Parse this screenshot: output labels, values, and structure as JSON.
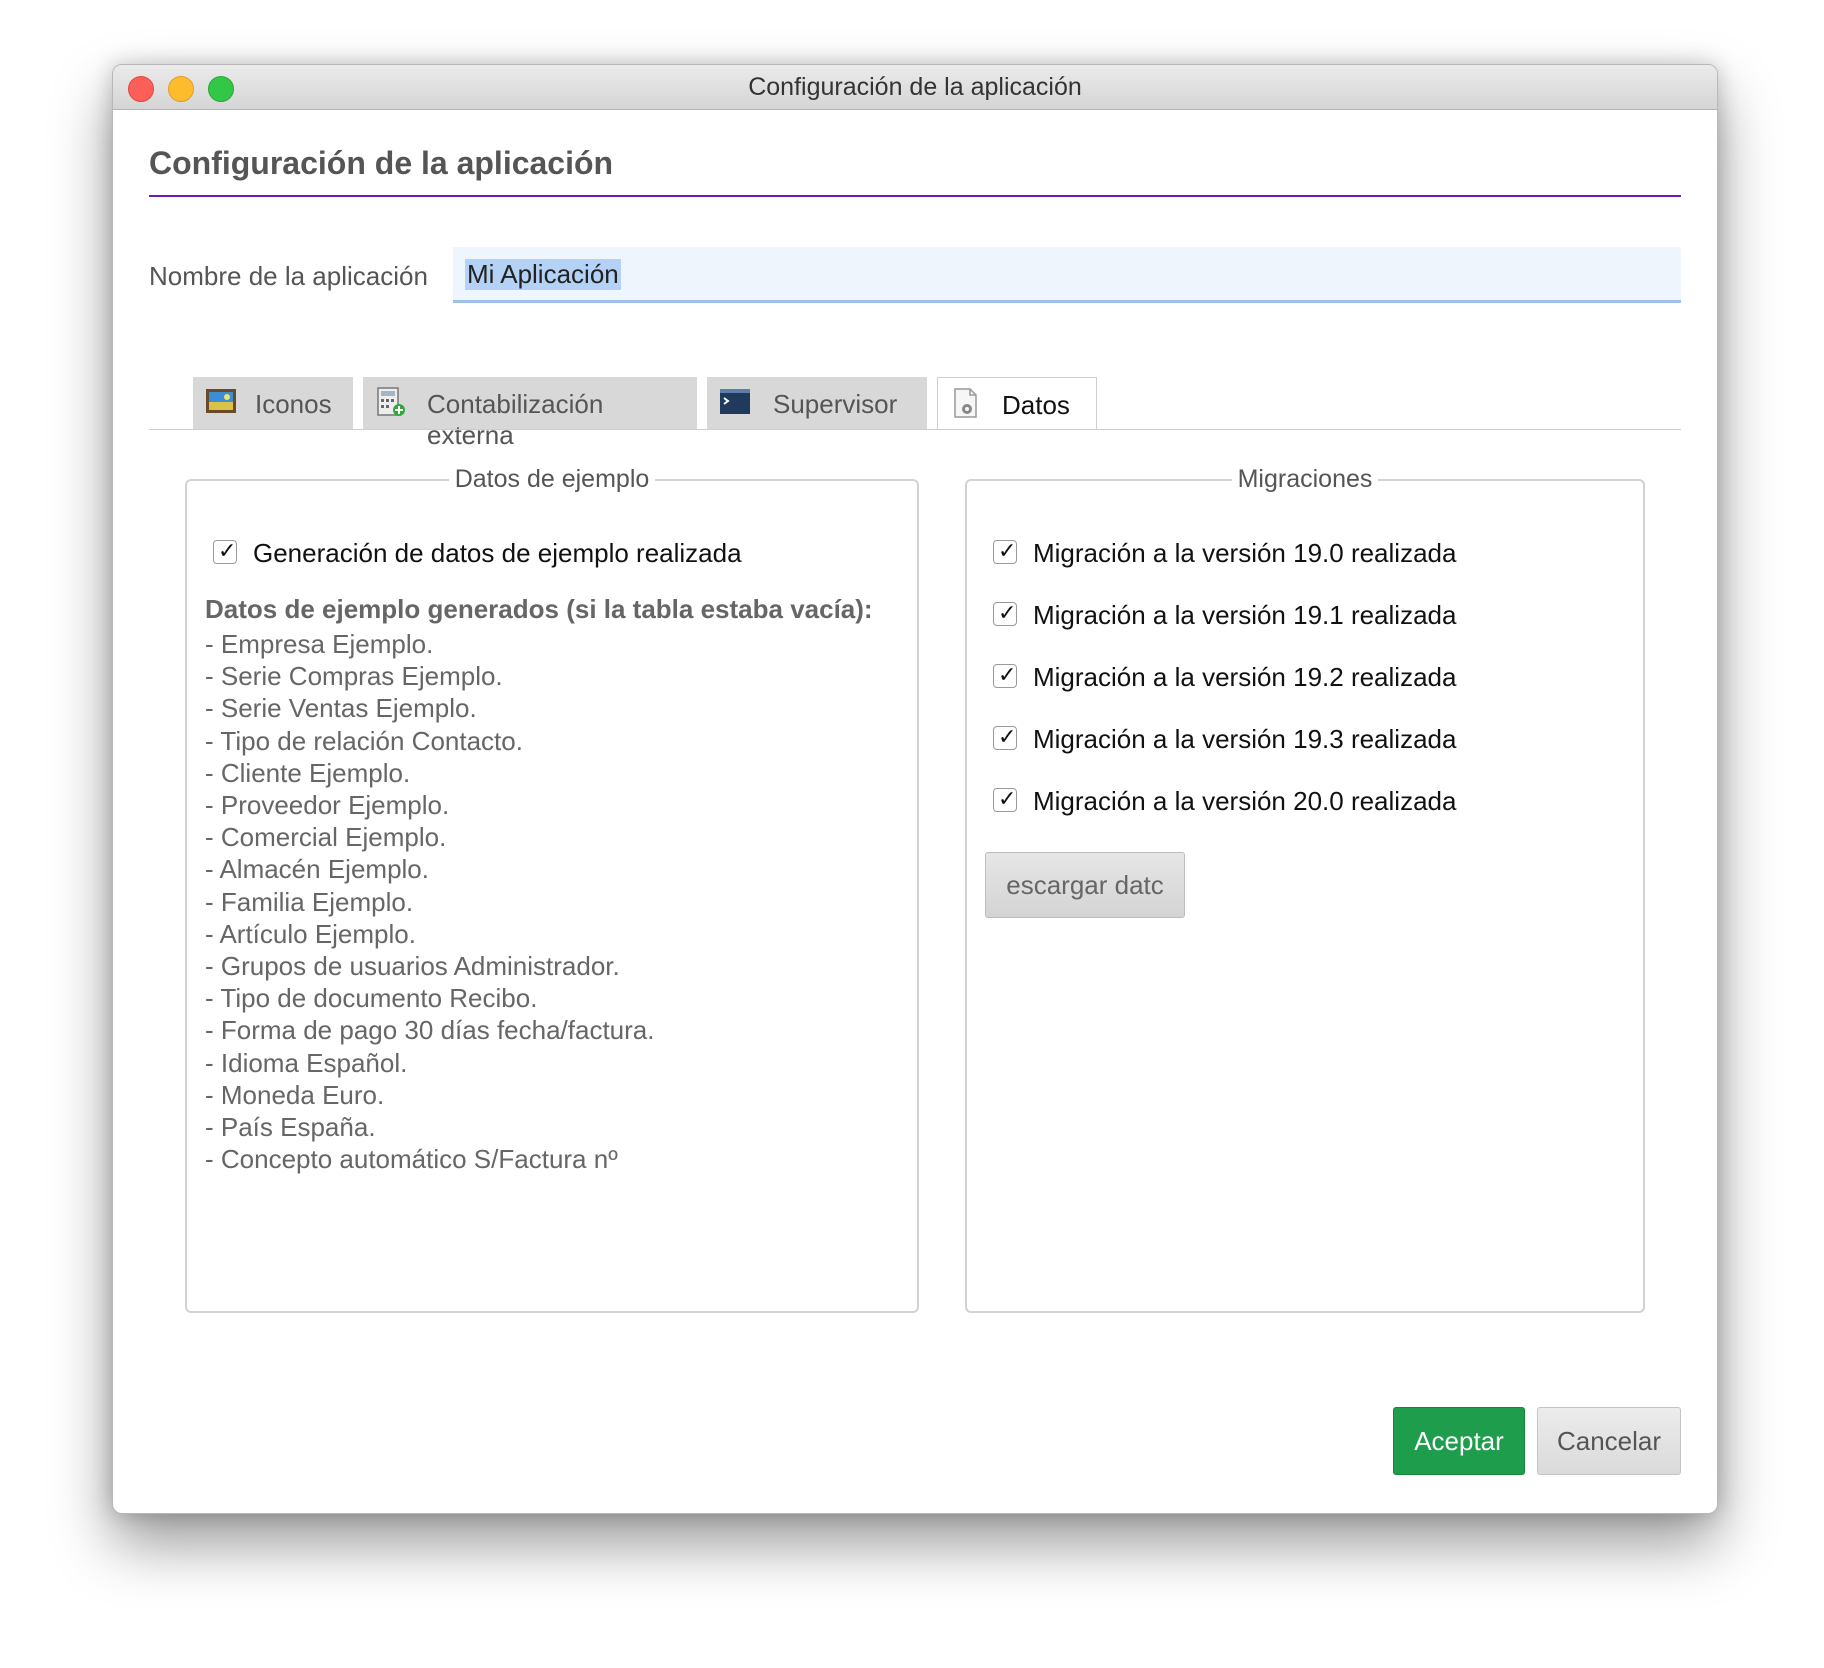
{
  "window": {
    "title": "Configuración de la aplicación"
  },
  "header": {
    "title": "Configuración de la aplicación"
  },
  "app_name": {
    "label": "Nombre de la aplicación",
    "value": "Mi Aplicación"
  },
  "tabs": [
    {
      "label": "Iconos",
      "icon": "image-icon",
      "active": false
    },
    {
      "label": "Contabilización externa",
      "icon": "calculator-icon",
      "active": false
    },
    {
      "label": "Supervisor",
      "icon": "terminal-icon",
      "active": false
    },
    {
      "label": "Datos",
      "icon": "document-gear-icon",
      "active": true
    }
  ],
  "sample_data": {
    "legend": "Datos de ejemplo",
    "checkbox_label": "Generación de datos de ejemplo realizada",
    "checked": true,
    "list_title": "Datos de ejemplo generados (si la tabla estaba vacía):",
    "items": [
      "- Empresa Ejemplo.",
      "- Serie Compras Ejemplo.",
      "- Serie Ventas Ejemplo.",
      "- Tipo de relación Contacto.",
      "- Cliente Ejemplo.",
      "- Proveedor Ejemplo.",
      "- Comercial Ejemplo.",
      "- Almacén Ejemplo.",
      "- Familia Ejemplo.",
      "- Artículo Ejemplo.",
      "- Grupos de usuarios Administrador.",
      "- Tipo de documento Recibo.",
      "- Forma de pago 30 días fecha/factura.",
      "- Idioma Español.",
      "- Moneda Euro.",
      "- País España.",
      "- Concepto automático S/Factura nº"
    ]
  },
  "migrations": {
    "legend": "Migraciones",
    "items": [
      {
        "label": "Migración a la versión 19.0 realizada",
        "checked": true
      },
      {
        "label": "Migración a la versión 19.1 realizada",
        "checked": true
      },
      {
        "label": "Migración a la versión 19.2 realizada",
        "checked": true
      },
      {
        "label": "Migración a la versión 19.3 realizada",
        "checked": true
      },
      {
        "label": "Migración a la versión 20.0 realizada",
        "checked": true
      }
    ],
    "download_button": "escargar datc"
  },
  "footer": {
    "accept": "Aceptar",
    "cancel": "Cancelar"
  },
  "colors": {
    "accent_rule": "#6a1fb0",
    "accept": "#1e9e4c",
    "input_bg": "#eef5fd"
  }
}
